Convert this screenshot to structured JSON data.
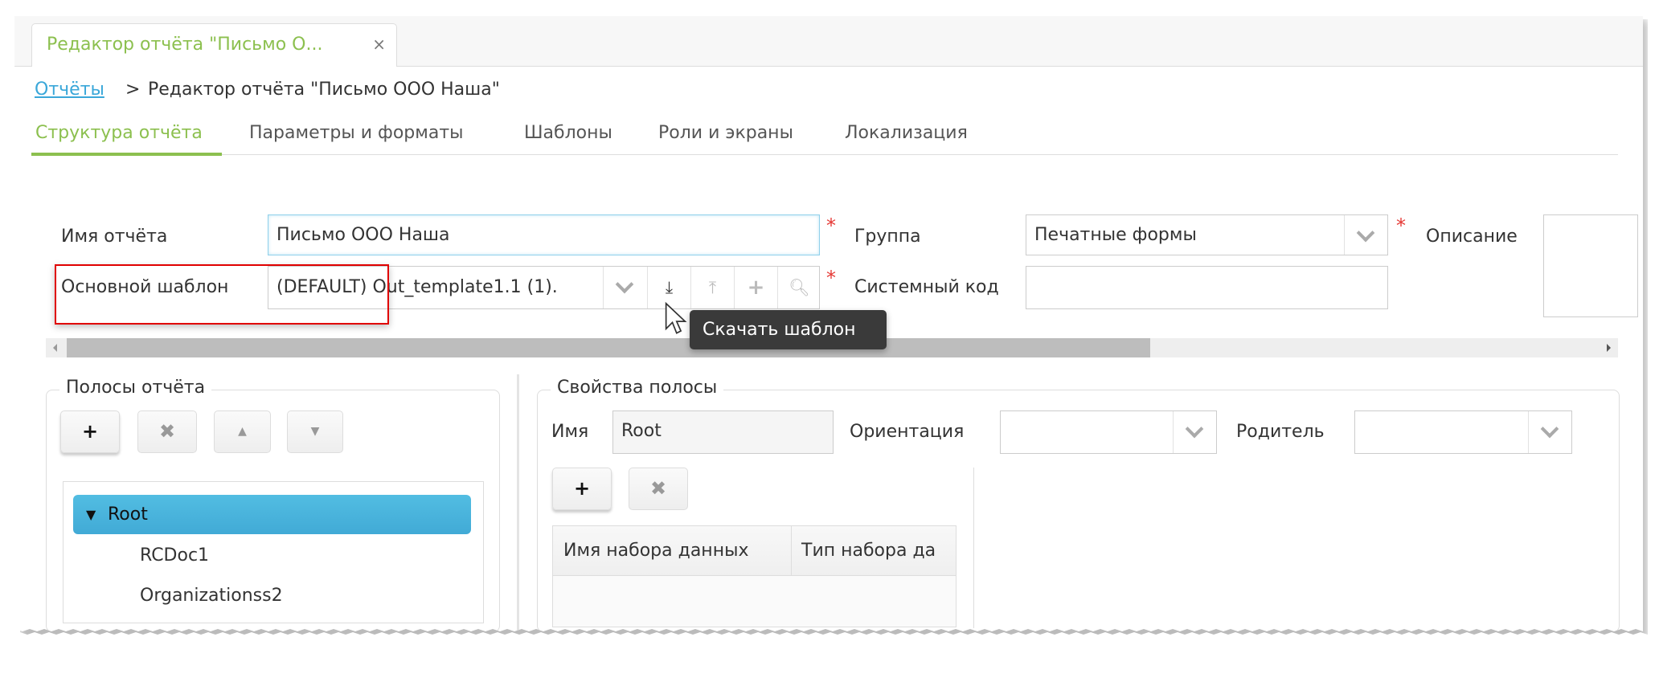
{
  "window_tab": {
    "title": "Редактор отчёта \"Письмо О...",
    "close": "×"
  },
  "breadcrumb": {
    "link": "Отчёты",
    "separator": ">",
    "current": "Редактор отчёта \"Письмо ООО Наша\""
  },
  "tabs": [
    {
      "label": "Структура отчёта",
      "active": true
    },
    {
      "label": "Параметры и форматы"
    },
    {
      "label": "Шаблоны"
    },
    {
      "label": "Роли и экраны"
    },
    {
      "label": "Локализация"
    }
  ],
  "form": {
    "name_label": "Имя отчёта",
    "name_value": "Письмо ООО Наша",
    "template_label": "Основной шаблон",
    "template_value": "(DEFAULT) Out_template1.1 (1).",
    "group_label": "Группа",
    "group_value": "Печатные формы",
    "syscode_label": "Системный код",
    "syscode_value": "",
    "description_label": "Описание",
    "required_mark": "*"
  },
  "template_buttons": [
    "chevron-down-icon",
    "download-icon",
    "upload-icon",
    "plus-icon",
    "search-icon"
  ],
  "tooltip": "Скачать шаблон",
  "bands": {
    "legend": "Полосы отчёта",
    "tree": [
      {
        "label": "Root",
        "selected": true,
        "expanded": true
      },
      {
        "label": "RCDoc1"
      },
      {
        "label": "Organizationss2"
      }
    ]
  },
  "band_props": {
    "legend": "Свойства полосы",
    "name_label": "Имя",
    "name_value": "Root",
    "orientation_label": "Ориентация",
    "orientation_value": "",
    "parent_label": "Родитель",
    "parent_value": "",
    "table_headers": [
      "Имя набора данных",
      "Тип набора да"
    ]
  },
  "colors": {
    "accent_green": "#8cc04f",
    "link_blue": "#3aa7d9",
    "selection_blue": "#4ab5dc",
    "highlight_red": "#e00000"
  }
}
